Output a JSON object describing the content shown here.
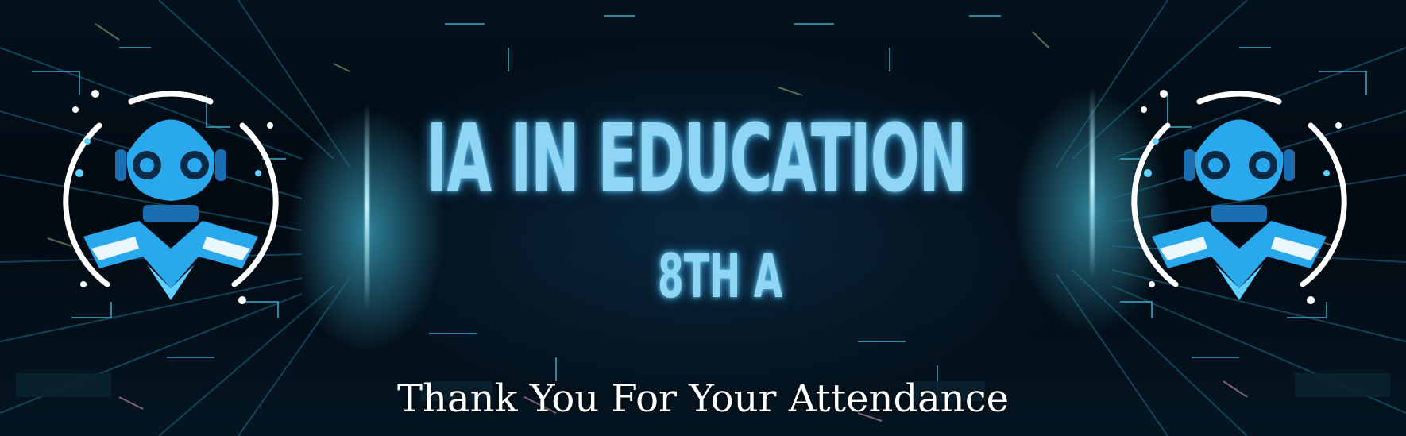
{
  "banner": {
    "title": "IA IN EDUCATION",
    "subtitle": "8TH A",
    "message": "Thank You For Your Attendance"
  },
  "colors": {
    "title_glow": "#8fd6f4",
    "robot_primary": "#2aa8ee",
    "robot_light": "#5fd0ff",
    "message_text": "#ffffff",
    "background": "#020a12"
  },
  "icons": {
    "left": "robot-logo-icon",
    "right": "robot-logo-icon"
  }
}
